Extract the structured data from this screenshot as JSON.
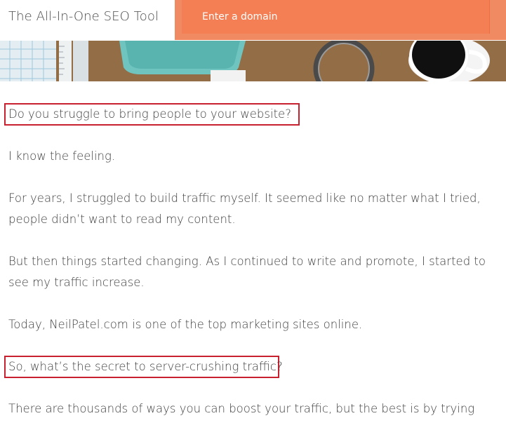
{
  "header": {
    "brand": "The All-In-One SEO Tool",
    "domain_placeholder": "Enter a domain"
  },
  "hero_image": {
    "alt": "desk-with-coffee-and-office-supplies"
  },
  "article": {
    "p1": "Do you struggle to bring people to your website?",
    "p2": "I know the feeling.",
    "p3_line1": "For years, I struggled to build traffic myself. It seemed like no matter what I tried,",
    "p3_line2": "people didn’t want to read my content.",
    "p4_line1": "But then things started changing. As I continued to write and promote, I started to",
    "p4_line2": "see my traffic increase.",
    "p5": "Today, NeilPatel.com is one of the top marketing sites online.",
    "p6": "So, what’s the secret to server-crushing traffic?",
    "p7": "There are thousands of ways you can boost your traffic, but the best is by trying"
  },
  "colors": {
    "accent_orange": "#f47f55",
    "highlight_red": "#c8202f"
  }
}
